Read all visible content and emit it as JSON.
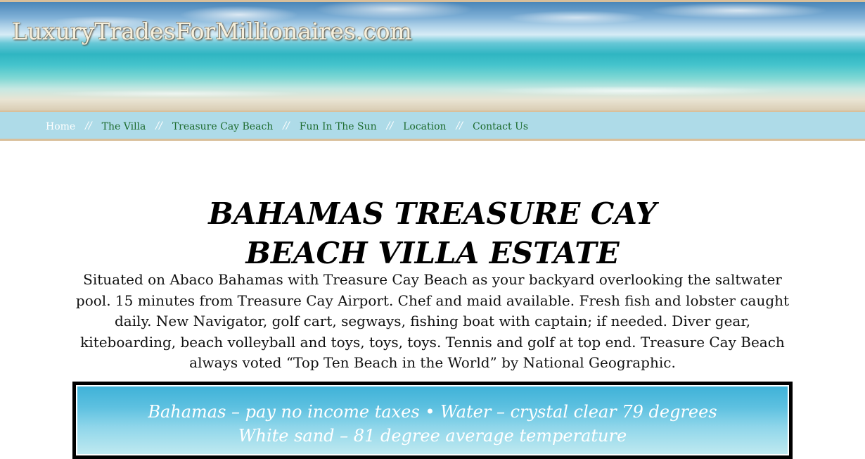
{
  "header": {
    "site_title": "LuxuryTradesForMillionaires.com"
  },
  "nav": {
    "items": [
      {
        "label": "Home"
      },
      {
        "label": "The Villa"
      },
      {
        "label": "Treasure Cay Beach"
      },
      {
        "label": "Fun In The Sun"
      },
      {
        "label": "Location"
      },
      {
        "label": "Contact Us"
      }
    ],
    "separator": "//"
  },
  "main": {
    "headline_line1": "BAHAMAS TREASURE CAY",
    "headline_line2": "BEACH VILLA ESTATE",
    "intro": "Situated on Abaco Bahamas with Treasure Cay Beach as your backyard overlooking the saltwater pool. 15 minutes from Treasure Cay Airport.  Chef and maid available. Fresh fish and lobster caught daily.  New Navigator, golf cart,  segways, fishing boat with captain; if needed. Diver gear, kiteboarding, beach volleyball and toys, toys, toys. Tennis and golf at top end. Treasure Cay Beach always voted “Top Ten Beach in the World” by National Geographic.",
    "promo_line1": "Bahamas – pay no income taxes   •   Water – crystal clear 79 degrees",
    "promo_line2": "White sand – 81 degree average temperature"
  },
  "colors": {
    "nav_background": "#aedbe8",
    "nav_link": "#1d6b2e",
    "nav_active": "#ffffff",
    "banner_border": "#d9bf9a"
  }
}
